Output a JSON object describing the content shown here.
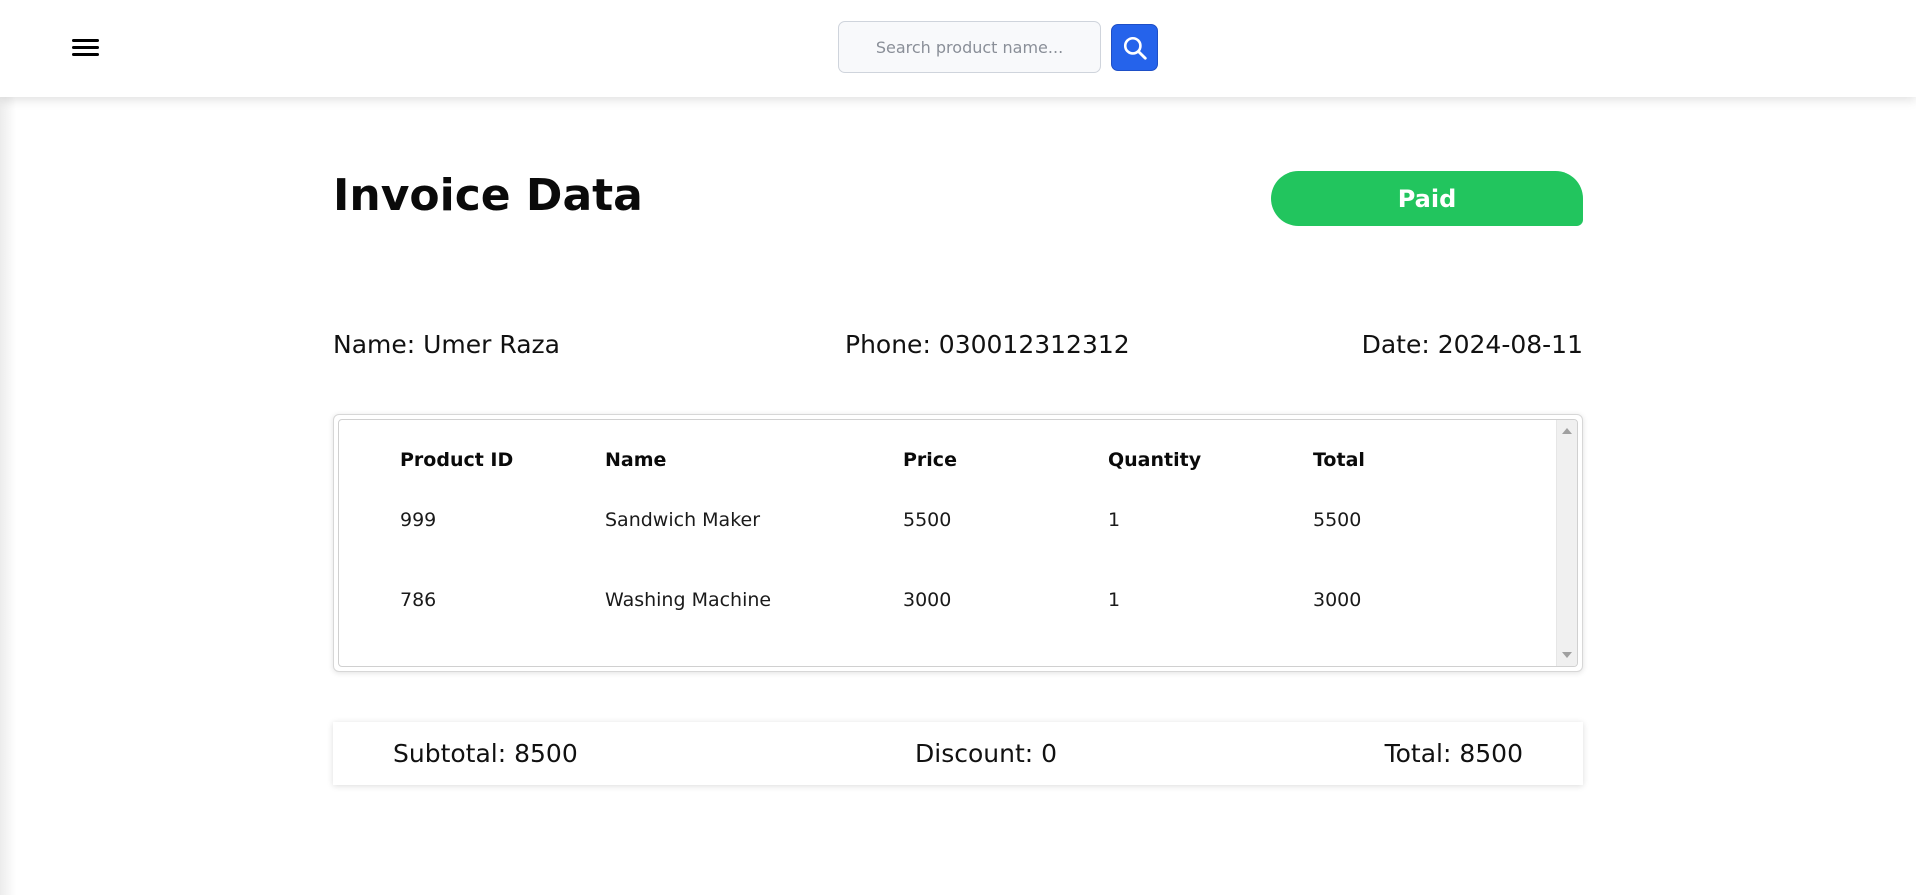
{
  "header": {
    "search": {
      "placeholder": "Search product name..."
    }
  },
  "invoice": {
    "title": "Invoice Data",
    "status": "Paid",
    "customer": {
      "name_text": "Name: Umer Raza",
      "phone_text": "Phone: 030012312312",
      "date_text": "Date: 2024-08-11"
    },
    "table": {
      "headers": [
        "Product ID",
        "Name",
        "Price",
        "Quantity",
        "Total"
      ],
      "rows": [
        [
          "999",
          "Sandwich Maker",
          "5500",
          "1",
          "5500"
        ],
        [
          "786",
          "Washing Machine",
          "3000",
          "1",
          "3000"
        ]
      ]
    },
    "summary": {
      "subtotal_text": "Subtotal: 8500",
      "discount_text": "Discount: 0",
      "total_text": "Total: 8500"
    }
  },
  "colors": {
    "accent": "#2563eb",
    "status_paid": "#22c55e"
  },
  "icons": {
    "menu": "hamburger-menu-icon",
    "search": "search-icon"
  }
}
